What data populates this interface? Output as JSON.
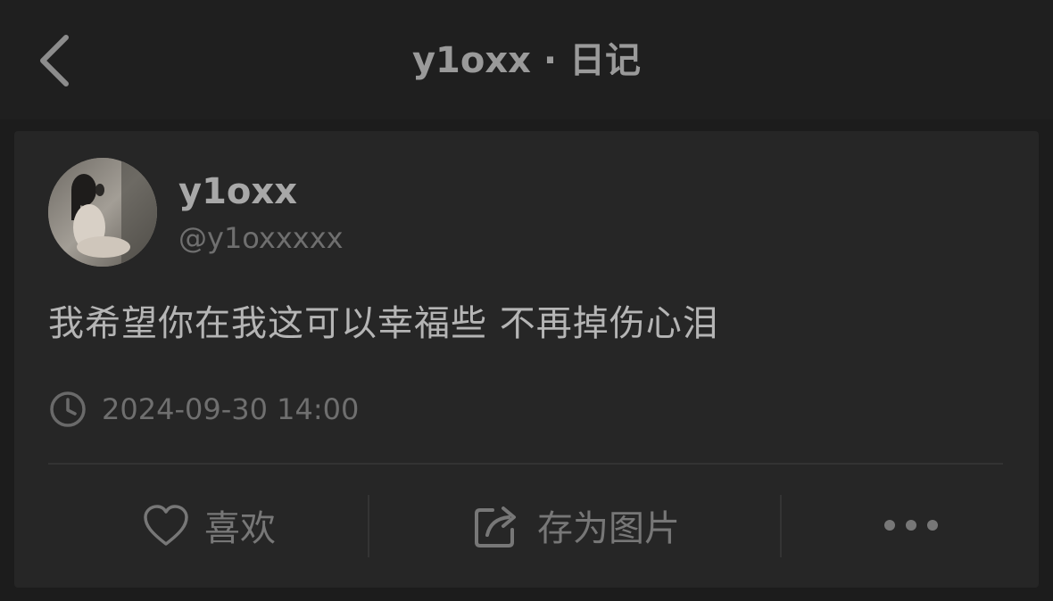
{
  "header": {
    "title": "y1oxx · 日记",
    "back_icon": "chevron-left-icon"
  },
  "post": {
    "avatar_icon": "avatar",
    "username": "y1oxx",
    "handle": "@y1oxxxxx",
    "text": "我希望你在我这可以幸福些 不再掉伤心泪",
    "timestamp_icon": "clock-icon",
    "timestamp": "2024-09-30 14:00"
  },
  "actions": {
    "like_label": "喜欢",
    "like_icon": "heart-icon",
    "save_label": "存为图片",
    "save_icon": "share-image-icon",
    "more_icon": "more-horizontal-icon"
  },
  "colors": {
    "background": "#1c1c1c",
    "card": "#262626",
    "primary_text": "#b5b5b5",
    "secondary_text": "#6f6f6f"
  }
}
